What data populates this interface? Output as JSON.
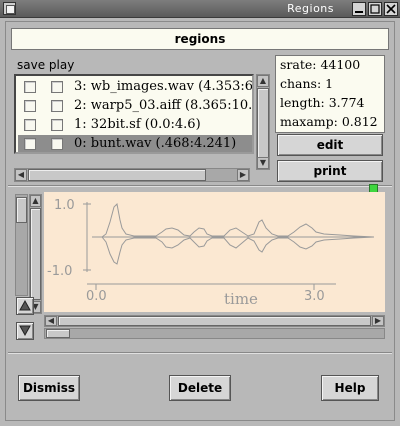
{
  "window": {
    "title": "Regions"
  },
  "header": {
    "title": "regions"
  },
  "list": {
    "columns_label": "save play",
    "rows": [
      {
        "label": "3: wb_images.wav (4.353:6.8",
        "selected": false
      },
      {
        "label": "2: warp5_03.aiff (8.365:10.71",
        "selected": false
      },
      {
        "label": "1: 32bit.sf (0.0:4.6)",
        "selected": false
      },
      {
        "label": "0: bunt.wav (.468:4.241)",
        "selected": true
      }
    ]
  },
  "info": {
    "srate": "srate: 44100",
    "chans": "chans: 1",
    "length": "length: 3.774",
    "maxamp": "maxamp: 0.812"
  },
  "buttons": {
    "edit": "edit",
    "print": "print"
  },
  "graph": {
    "y_ticks": [
      "1.0",
      "-1.0"
    ],
    "x_ticks": [
      "0.0",
      "3.0"
    ],
    "xlabel": "time"
  },
  "footer": {
    "dismiss": "Dismiss",
    "delete": "Delete",
    "help": "Help"
  },
  "colors": {
    "list_bg": "#fbfbf0",
    "plot_bg": "#fbe8d2",
    "selected_row": "#8d8d8d",
    "waveform": "#9a9a9a"
  }
}
